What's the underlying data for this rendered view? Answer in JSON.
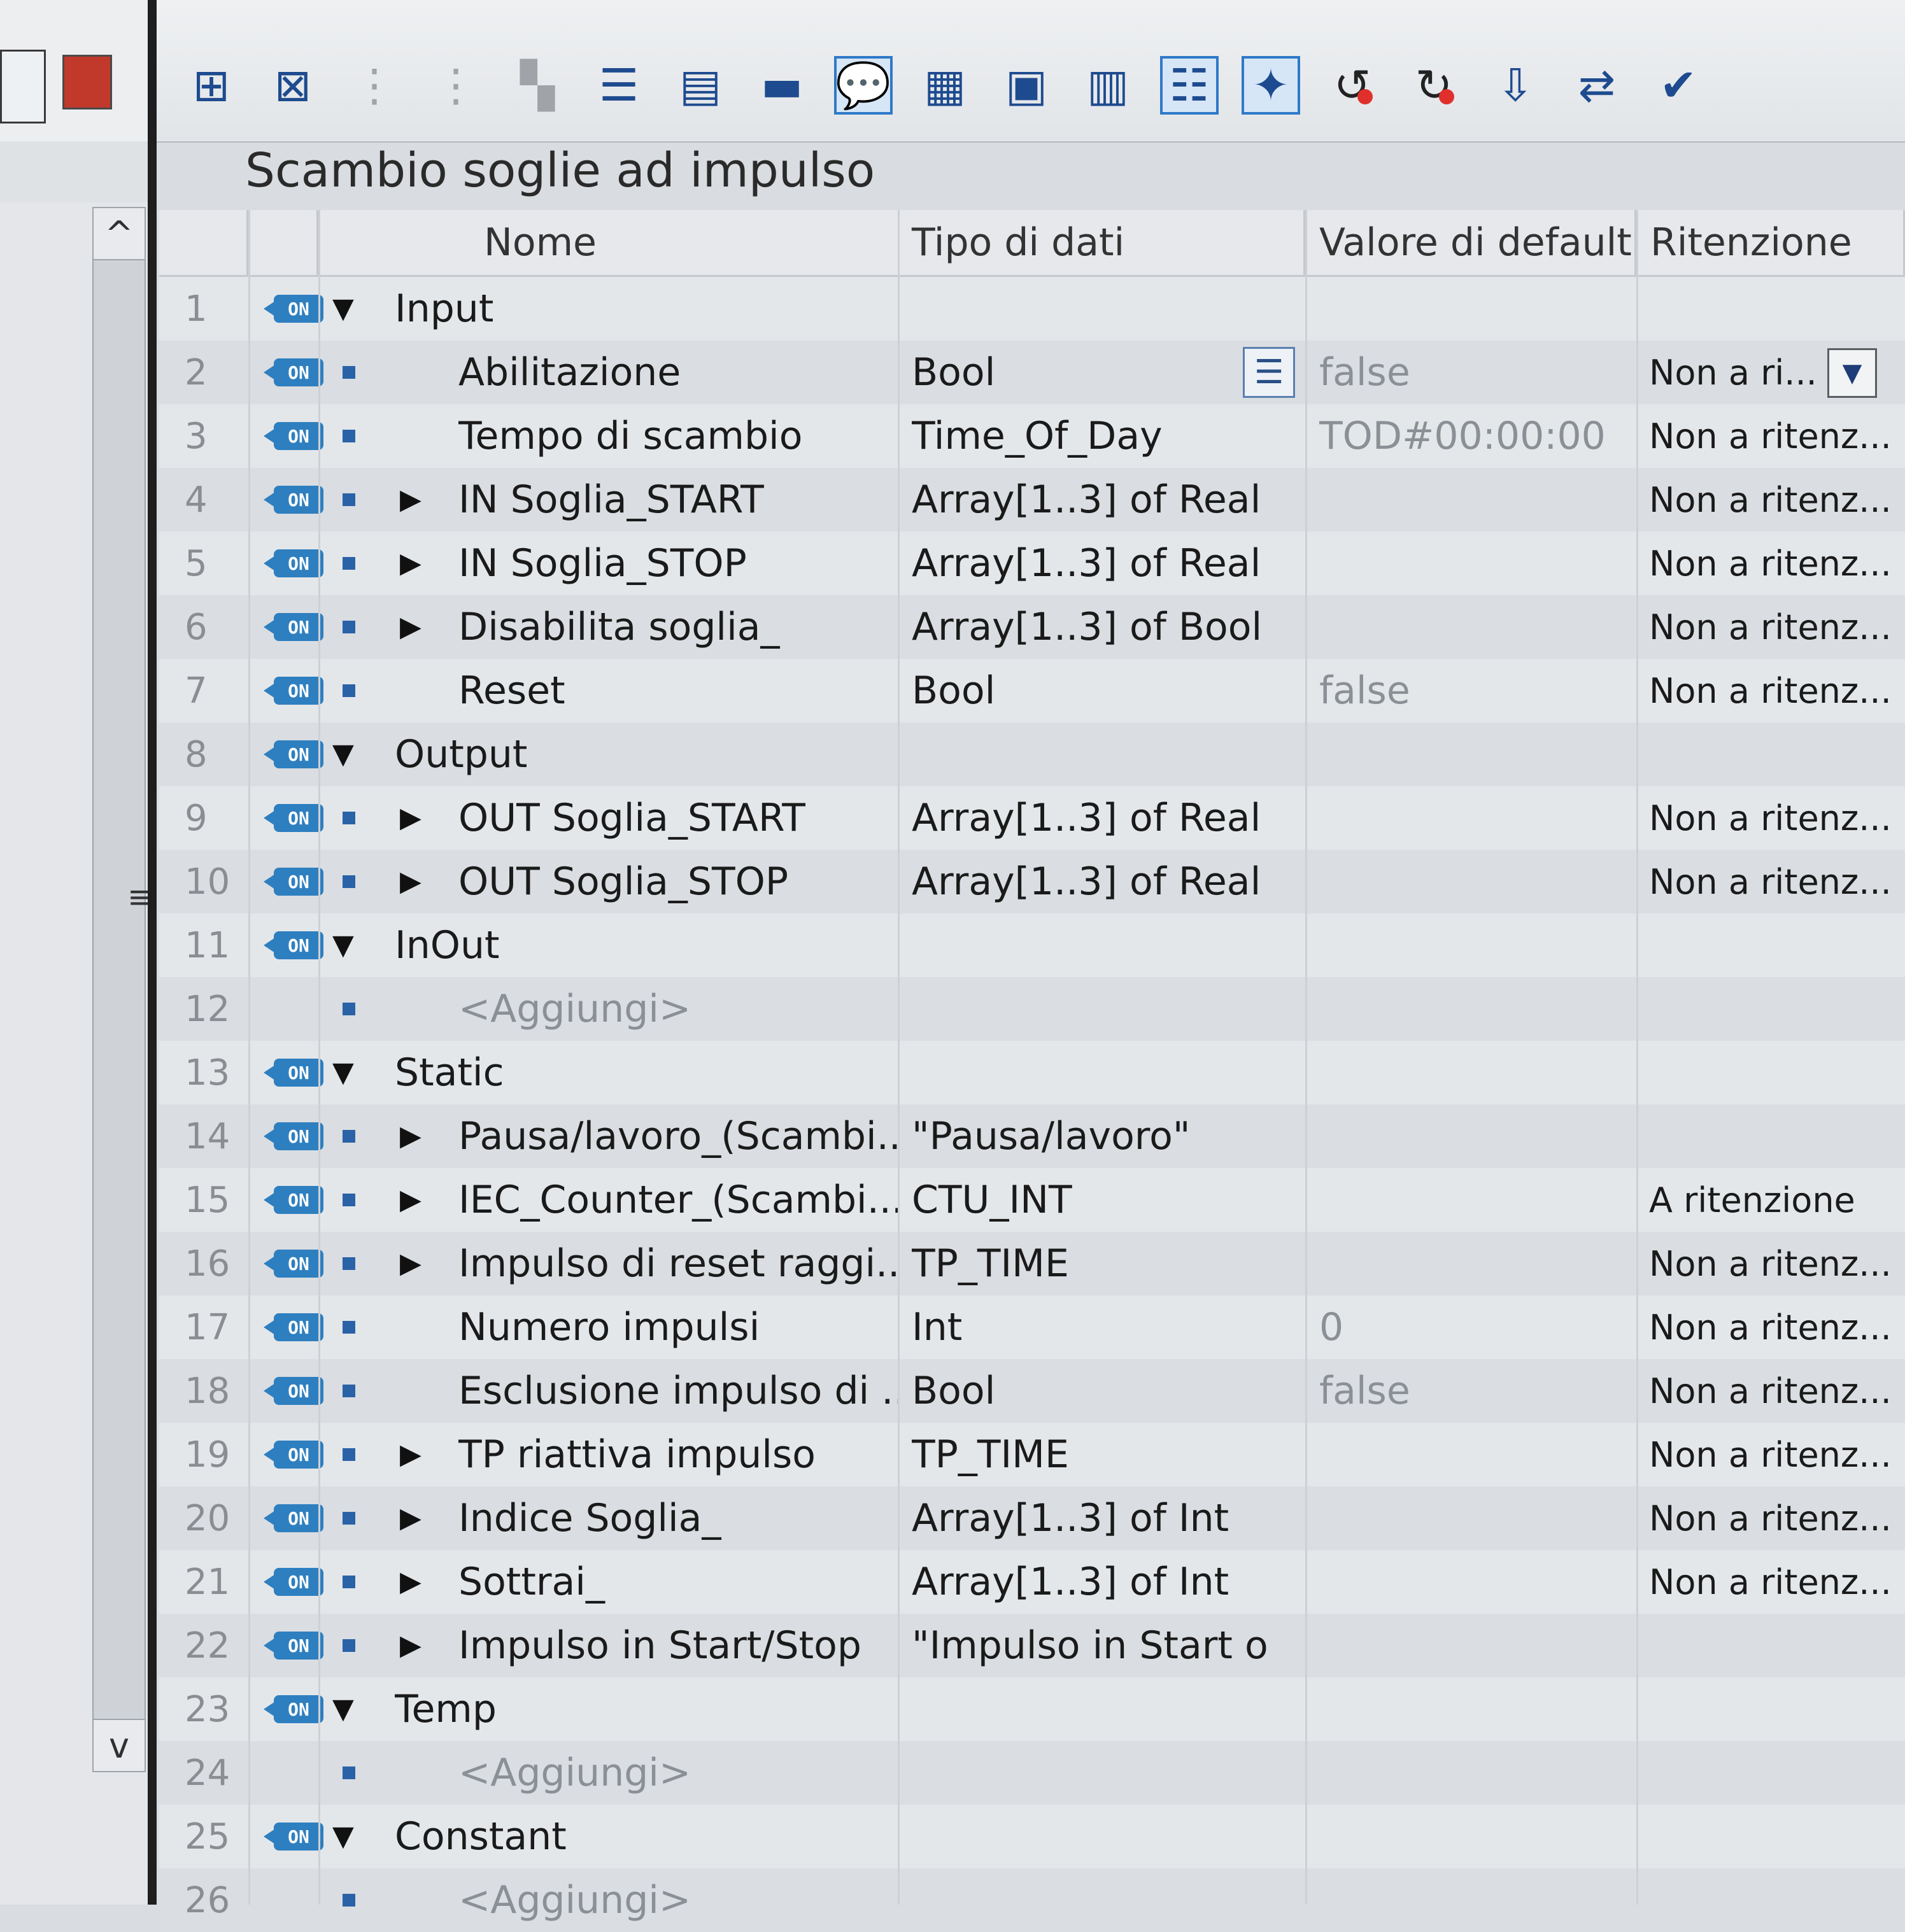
{
  "left_panel": {
    "scroll_up": "^",
    "scroll_down": "v",
    "grip": "≡"
  },
  "toolbar": {
    "icons": [
      "insert-row-icon",
      "delete-row-icon",
      "insert-row-above-icon",
      "insert-row-below-icon",
      "copy-icon",
      "expand-all-icon",
      "collapse-all-icon",
      "block-view-icon",
      "comment-icon",
      "monitor-icon",
      "snapshot-icon",
      "load-icon",
      "indent-icon",
      "star-icon",
      "reset-start-icon",
      "reset-icon",
      "download-icon",
      "compare-icon",
      "settings-icon"
    ]
  },
  "title": "Scambio soglie ad impulso",
  "columns": {
    "name": "Nome",
    "type": "Tipo di dati",
    "default": "Valore di default",
    "retention": "Ritenzione"
  },
  "port_icon_label": "ON",
  "rows": [
    {
      "n": "1",
      "name": "Input",
      "type": "",
      "default": "",
      "ret": "",
      "level": 0,
      "expander": "down",
      "icon": true
    },
    {
      "n": "2",
      "name": "Abilitazione",
      "type": "Bool",
      "default": "false",
      "ret": "Non a ri...",
      "level": 1,
      "expander": "",
      "icon": true
    },
    {
      "n": "3",
      "name": "Tempo di scambio",
      "type": "Time_Of_Day",
      "default": "TOD#00:00:00",
      "ret": "Non a ritenz...",
      "level": 1,
      "expander": "",
      "icon": true
    },
    {
      "n": "4",
      "name": "IN Soglia_START",
      "type": "Array[1..3] of Real",
      "default": "",
      "ret": "Non a ritenz...",
      "level": 1,
      "expander": "right",
      "icon": true
    },
    {
      "n": "5",
      "name": "IN Soglia_STOP",
      "type": "Array[1..3] of Real",
      "default": "",
      "ret": "Non a ritenz...",
      "level": 1,
      "expander": "right",
      "icon": true
    },
    {
      "n": "6",
      "name": "Disabilita soglia_",
      "type": "Array[1..3] of Bool",
      "default": "",
      "ret": "Non a ritenz...",
      "level": 1,
      "expander": "right",
      "icon": true
    },
    {
      "n": "7",
      "name": "Reset",
      "type": "Bool",
      "default": "false",
      "ret": "Non a ritenz...",
      "level": 1,
      "expander": "",
      "icon": true
    },
    {
      "n": "8",
      "name": "Output",
      "type": "",
      "default": "",
      "ret": "",
      "level": 0,
      "expander": "down",
      "icon": true
    },
    {
      "n": "9",
      "name": "OUT Soglia_START",
      "type": "Array[1..3] of Real",
      "default": "",
      "ret": "Non a ritenz...",
      "level": 1,
      "expander": "right",
      "icon": true
    },
    {
      "n": "10",
      "name": "OUT Soglia_STOP",
      "type": "Array[1..3] of Real",
      "default": "",
      "ret": "Non a ritenz...",
      "level": 1,
      "expander": "right",
      "icon": true
    },
    {
      "n": "11",
      "name": "InOut",
      "type": "",
      "default": "",
      "ret": "",
      "level": 0,
      "expander": "down",
      "icon": true
    },
    {
      "n": "12",
      "name": "<Aggiungi>",
      "type": "",
      "default": "",
      "ret": "",
      "level": 1,
      "expander": "",
      "icon": false,
      "muted": true
    },
    {
      "n": "13",
      "name": "Static",
      "type": "",
      "default": "",
      "ret": "",
      "level": 0,
      "expander": "down",
      "icon": true
    },
    {
      "n": "14",
      "name": "Pausa/lavoro_(Scambi..",
      "type": "\"Pausa/lavoro\"",
      "default": "",
      "ret": "",
      "level": 1,
      "expander": "right",
      "icon": true
    },
    {
      "n": "15",
      "name": "IEC_Counter_(Scambi...",
      "type": "CTU_INT",
      "default": "",
      "ret": "A ritenzione",
      "level": 1,
      "expander": "right",
      "icon": true
    },
    {
      "n": "16",
      "name": "Impulso di reset raggi...",
      "type": "TP_TIME",
      "default": "",
      "ret": "Non a ritenz...",
      "level": 1,
      "expander": "right",
      "icon": true
    },
    {
      "n": "17",
      "name": "Numero impulsi",
      "type": "Int",
      "default": "0",
      "ret": "Non a ritenz...",
      "level": 1,
      "expander": "",
      "icon": true
    },
    {
      "n": "18",
      "name": "Esclusione impulso di ..",
      "type": "Bool",
      "default": "false",
      "ret": "Non a ritenz...",
      "level": 1,
      "expander": "",
      "icon": true
    },
    {
      "n": "19",
      "name": "TP riattiva impulso",
      "type": "TP_TIME",
      "default": "",
      "ret": "Non a ritenz...",
      "level": 1,
      "expander": "right",
      "icon": true
    },
    {
      "n": "20",
      "name": "Indice Soglia_",
      "type": "Array[1..3] of Int",
      "default": "",
      "ret": "Non a ritenz...",
      "level": 1,
      "expander": "right",
      "icon": true
    },
    {
      "n": "21",
      "name": "Sottrai_",
      "type": "Array[1..3] of Int",
      "default": "",
      "ret": "Non a ritenz...",
      "level": 1,
      "expander": "right",
      "icon": true
    },
    {
      "n": "22",
      "name": "Impulso in Start/Stop",
      "type": "\"Impulso in Start o i..",
      "default": "",
      "ret": "",
      "level": 1,
      "expander": "right",
      "icon": true
    },
    {
      "n": "23",
      "name": "Temp",
      "type": "",
      "default": "",
      "ret": "",
      "level": 0,
      "expander": "down",
      "icon": true
    },
    {
      "n": "24",
      "name": "<Aggiungi>",
      "type": "",
      "default": "",
      "ret": "",
      "level": 1,
      "expander": "",
      "icon": false,
      "muted": true
    },
    {
      "n": "25",
      "name": "Constant",
      "type": "",
      "default": "",
      "ret": "",
      "level": 0,
      "expander": "down",
      "icon": true
    },
    {
      "n": "26",
      "name": "<Aggiungi>",
      "type": "",
      "default": "",
      "ret": "",
      "level": 1,
      "expander": "",
      "icon": false,
      "muted": true
    }
  ],
  "colors": {
    "accent": "#2e7fc0",
    "grid": "#cdd1d5"
  }
}
